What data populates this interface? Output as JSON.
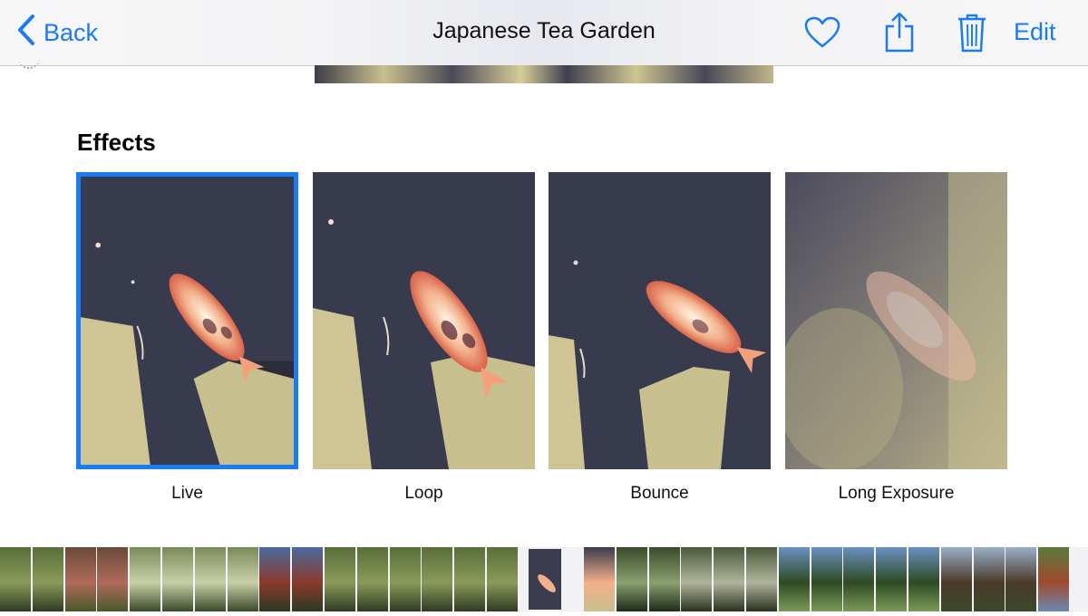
{
  "nav": {
    "back_label": "Back",
    "title": "Japanese Tea Garden",
    "edit_label": "Edit",
    "icons": [
      "chevron-left-icon",
      "heart-icon",
      "share-icon",
      "trash-icon"
    ],
    "accent_color": "#1a7cf5"
  },
  "effects": {
    "title": "Effects",
    "items": [
      {
        "label": "Live",
        "selected": true
      },
      {
        "label": "Loop",
        "selected": false
      },
      {
        "label": "Bounce",
        "selected": false
      },
      {
        "label": "Long Exposure",
        "selected": false
      }
    ]
  },
  "filmstrip": {
    "thumbnails": [
      "garden",
      "garden",
      "garden-flowers",
      "garden-flowers",
      "tree",
      "tree",
      "tree",
      "tree",
      "pagoda",
      "pagoda",
      "garden",
      "garden",
      "garden",
      "garden",
      "garden",
      "garden",
      "koi",
      "pond",
      "pond",
      "stone-lantern",
      "stone-lantern",
      "stone-lantern",
      "cypress",
      "cypress",
      "cypress",
      "cypress",
      "cypress",
      "bridge",
      "bridge",
      "bridge",
      "statue",
      "portrait",
      "portrait",
      "portrait",
      "portrait"
    ]
  }
}
